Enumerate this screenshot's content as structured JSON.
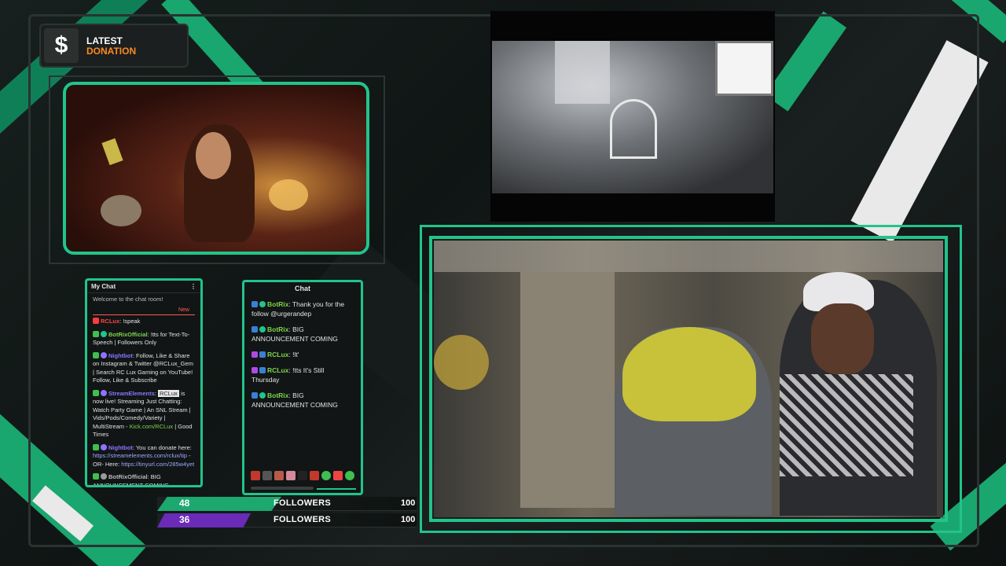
{
  "donation": {
    "icon": "dollar-icon",
    "symbol": "$",
    "line1": "LATEST",
    "line2": "DONATION"
  },
  "chat1": {
    "title": "My Chat",
    "welcome": "Welcome to the chat room!",
    "new_label": "New",
    "messages": [
      {
        "user": "RCLux",
        "text": ": !speak"
      },
      {
        "user": "BotRixOfficial",
        "text": ": !tts for Text-To-Speech | Followers Only"
      },
      {
        "user": "Nightbot",
        "text": ": Follow, Like & Share on Instagram & Twitter @RCLux_Gem | Search RC Lux Gaming on YouTube! Follow, Like & Subscribe"
      },
      {
        "user": "StreamElements",
        "mention": "RCLux",
        "text": " is now live! Streaming Just Chatting: Watch Party Game | An SNL Stream | Vids/Pods/Comedy/Variety | MultiStream - ",
        "link": "Kick.com/RCLux",
        "text2": " | Good Times"
      },
      {
        "user": "Nightbot",
        "text": ": You can donate here: ",
        "link": "https://streamelements.com/rclux/tip",
        "text2": " -OR- Here: ",
        "link2": "https://tinyurl.com/285w4yet"
      },
      {
        "user": "BotRixOfficial",
        "text": ": BIG ANNOUNCEMENT COMING"
      }
    ]
  },
  "chat2": {
    "title": "Chat",
    "messages": [
      {
        "user": "BotRix",
        "text": ": Thank you for the follow @urgerandep"
      },
      {
        "user": "BotRix",
        "text": ": BIG ANNOUNCEMENT COMING"
      },
      {
        "user": "RCLux",
        "text": ": !lt'"
      },
      {
        "user": "RCLux",
        "text": ": !tts It's Still Thursday"
      },
      {
        "user": "BotRix",
        "text": ": BIG ANNOUNCEMENT COMING"
      }
    ]
  },
  "followers": [
    {
      "count": "48",
      "label": "FOLLOWERS",
      "goal": "100",
      "progress": 0.48,
      "color": "#1ca86e"
    },
    {
      "count": "36",
      "label": "FOLLOWERS",
      "goal": "100",
      "progress": 0.36,
      "color": "#6a2bb8"
    }
  ],
  "colors": {
    "accent": "#21c48a",
    "donation": "#ff8a1e",
    "purple": "#6a2bb8"
  }
}
